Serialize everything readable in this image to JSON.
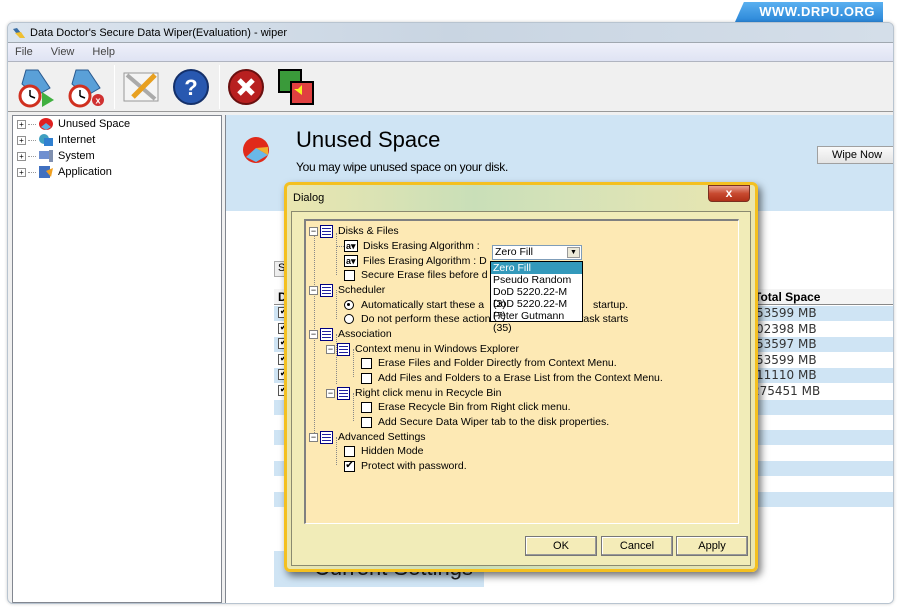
{
  "banner": "WWW.DRPU.ORG",
  "window": {
    "title": "Data Doctor's Secure Data Wiper(Evaluation) - wiper",
    "menu": [
      "File",
      "View",
      "Help"
    ],
    "toolbar": [
      {
        "icon": "schedule-start-icon"
      },
      {
        "icon": "schedule-stop-icon"
      },
      {
        "icon": "settings-tools-icon"
      },
      {
        "icon": "help-icon"
      },
      {
        "icon": "exit-icon"
      },
      {
        "icon": "switch-window-icon"
      }
    ]
  },
  "tree": {
    "items": [
      {
        "label": "Unused Space",
        "icon": "unused-space-icon"
      },
      {
        "label": "Internet",
        "icon": "internet-icon"
      },
      {
        "label": "System",
        "icon": "system-icon"
      },
      {
        "label": "Application",
        "icon": "application-icon"
      }
    ]
  },
  "main": {
    "title": "Unused Space",
    "subtitle": "You may wipe unused space on your disk.",
    "wipe_button": "Wipe Now",
    "tab_partial": "S",
    "col_drive": "D",
    "col_total": "Total Space",
    "rows": [
      {
        "checked": true,
        "total": "53599 MB"
      },
      {
        "checked": true,
        "total": "02398 MB"
      },
      {
        "checked": true,
        "total": "53597 MB"
      },
      {
        "checked": true,
        "total": "53599 MB"
      },
      {
        "checked": true,
        "total": "11110 MB"
      },
      {
        "checked": true,
        "total": "275451 MB"
      }
    ],
    "current_settings": "Current Settings"
  },
  "dialog": {
    "title": "Dialog",
    "close": "x",
    "disks_files": "Disks & Files",
    "disks_algo_label": "Disks Erasing Algorithm :",
    "disks_algo_value": "Zero Fill",
    "files_algo_label": "Files Erasing Algorithm : D",
    "secure_erase": "Secure Erase files before d",
    "dropdown_options": [
      "Zero Fill",
      "Pseudo Random",
      "DoD 5220.22-M (3)",
      "DoD 5220.22-M (7)",
      "Peter Gutmann (35)"
    ],
    "scheduler": "Scheduler",
    "auto_start": "Automatically start these a",
    "auto_start_tail": "startup.",
    "no_perform": "Do not perform these actions when a schedule task starts",
    "association": "Association",
    "context_menu": "Context menu in Windows Explorer",
    "erase_context": "Erase Files and Folder Directly from Context Menu.",
    "add_context": "Add Files and Folders to a Erase List from the Context Menu.",
    "recycle_menu": "Right click menu in Recycle Bin",
    "erase_recycle": "Erase Recycle Bin from Right click menu.",
    "add_tab": "Add Secure Data Wiper tab to the disk properties.",
    "advanced": "Advanced Settings",
    "hidden_mode": "Hidden Mode",
    "protect_password": "Protect with password.",
    "ok": "OK",
    "cancel": "Cancel",
    "apply": "Apply"
  }
}
